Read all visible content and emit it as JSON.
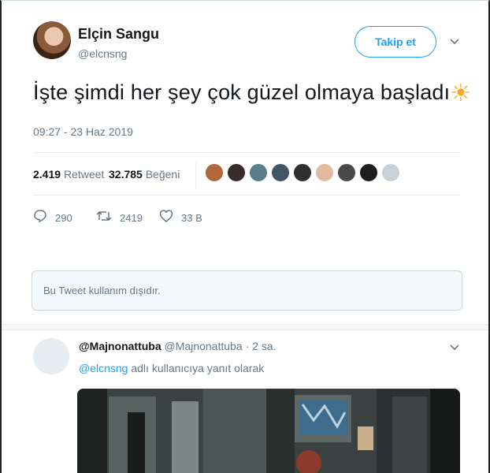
{
  "author": {
    "display_name": "Elçin Sangu",
    "handle": "@elcnsng",
    "follow_label": "Takip et"
  },
  "tweet": {
    "text": "İşte şimdi her şey çok güzel olmaya başladı",
    "emoji": "☀",
    "timestamp": "09:27 - 23 Haz 2019"
  },
  "stats": {
    "retweet_count": "2.419",
    "retweet_label": "Retweet",
    "like_count": "32.785",
    "like_label": "Beğeni"
  },
  "likers": [
    "#b0673a",
    "#3a2a2a",
    "#5a7d8e",
    "#445566",
    "#2f2f2f",
    "#e3b9a0",
    "#4a4a4a",
    "#1f1f1f",
    "#c8d1d8"
  ],
  "actions": {
    "reply_count": "290",
    "retweet_count": "2419",
    "like_count": "33 B"
  },
  "unavailable_notice": "Bu Tweet kullanım dışıdır.",
  "reply": {
    "name": "@Majnonattuba",
    "handle": "@Majnonattuba",
    "time": "2 sa.",
    "replying_to_prefix": "",
    "replying_to_mention": "@elcnsng",
    "replying_to_suffix": "adlı kullanıcıya yanıt olarak"
  },
  "colors": {
    "accent": "#1da1f2",
    "muted": "#657786",
    "sun": "#f5a623"
  }
}
